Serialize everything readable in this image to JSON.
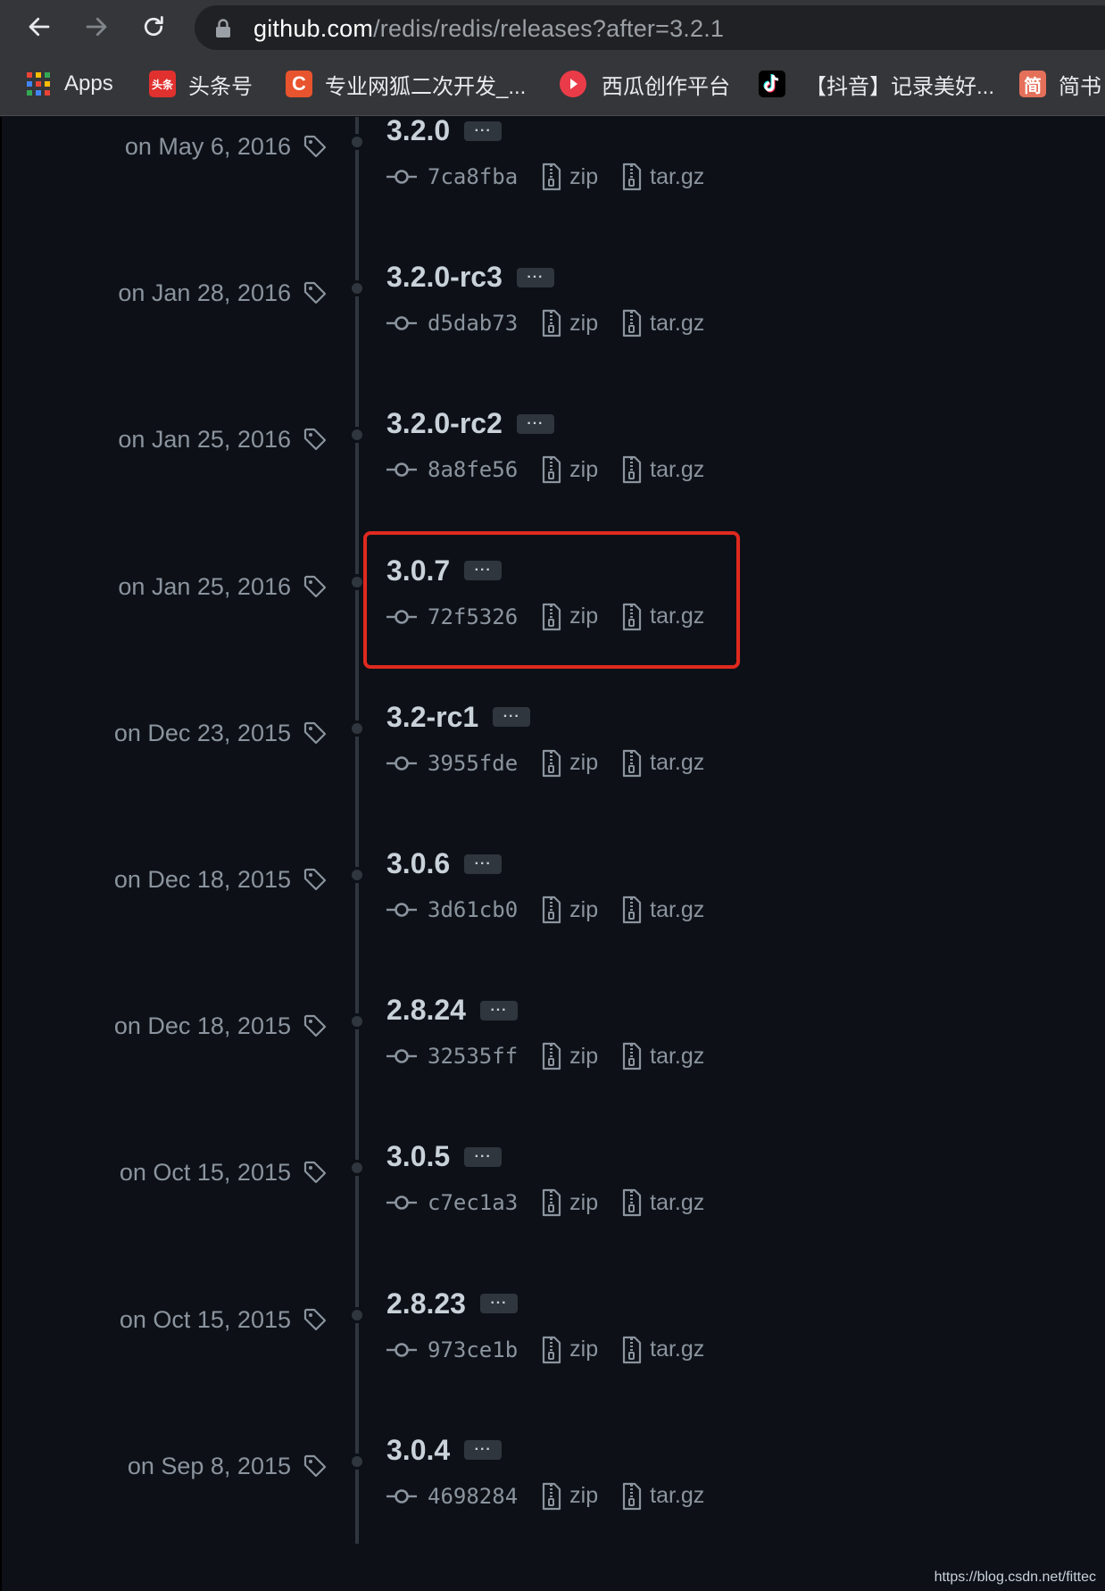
{
  "browser": {
    "url_host": "github.com",
    "url_path": "/redis/redis/releases?after=3.2.1",
    "bookmarks": [
      {
        "label": "Apps",
        "icon": "apps-grid-icon"
      },
      {
        "label": "头条号",
        "icon": "toutiao-icon",
        "icon_text": "头条",
        "color": "#e0312e"
      },
      {
        "label": "专业网狐二次开发_...",
        "icon": "csdn-c-icon",
        "icon_text": "C",
        "color": "#e8542d"
      },
      {
        "label": "西瓜创作平台",
        "icon": "xigua-icon",
        "color": "#ea3c48"
      },
      {
        "label": "【抖音】记录美好...",
        "icon": "douyin-icon",
        "color": "#000000"
      },
      {
        "label": "简书",
        "icon": "jianshu-icon",
        "icon_text": "简",
        "color": "#e5705a"
      }
    ]
  },
  "releases": [
    {
      "date": "on May 6, 2016",
      "version": "3.2.0",
      "sha": "7ca8fba"
    },
    {
      "date": "on Jan 28, 2016",
      "version": "3.2.0-rc3",
      "sha": "d5dab73"
    },
    {
      "date": "on Jan 25, 2016",
      "version": "3.2.0-rc2",
      "sha": "8a8fe56"
    },
    {
      "date": "on Jan 25, 2016",
      "version": "3.0.7",
      "sha": "72f5326"
    },
    {
      "date": "on Dec 23, 2015",
      "version": "3.2-rc1",
      "sha": "3955fde"
    },
    {
      "date": "on Dec 18, 2015",
      "version": "3.0.6",
      "sha": "3d61cb0"
    },
    {
      "date": "on Dec 18, 2015",
      "version": "2.8.24",
      "sha": "32535ff"
    },
    {
      "date": "on Oct 15, 2015",
      "version": "3.0.5",
      "sha": "c7ec1a3"
    },
    {
      "date": "on Oct 15, 2015",
      "version": "2.8.23",
      "sha": "973ce1b"
    },
    {
      "date": "on Sep 8, 2015",
      "version": "3.0.4",
      "sha": "4698284"
    }
  ],
  "assets": {
    "zip": "zip",
    "targz": "tar.gz"
  },
  "more_button": "···",
  "watermark": "https://blog.csdn.net/fittec",
  "colors": {
    "highlight": "#e0291f",
    "background": "#0d1117"
  }
}
